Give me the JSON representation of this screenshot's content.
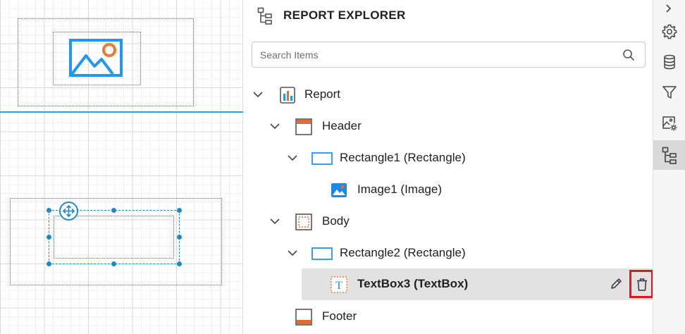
{
  "explorer": {
    "title": "REPORT EXPLORER",
    "search_placeholder": "Search Items",
    "tree": [
      {
        "label": "Report",
        "icon": "report-icon",
        "level": 0,
        "expanded": true
      },
      {
        "label": "Header",
        "icon": "header-band-icon",
        "level": 1,
        "expanded": true
      },
      {
        "label": "Rectangle1 (Rectangle)",
        "icon": "rectangle-icon",
        "level": 2,
        "expanded": true
      },
      {
        "label": "Image1 (Image)",
        "icon": "image-icon",
        "level": 3
      },
      {
        "label": "Body",
        "icon": "body-band-icon",
        "level": 1,
        "expanded": true
      },
      {
        "label": "Rectangle2 (Rectangle)",
        "icon": "rectangle-icon",
        "level": 2,
        "expanded": true
      },
      {
        "label": "TextBox3 (TextBox)",
        "icon": "textbox-icon",
        "level": 3,
        "selected": true
      },
      {
        "label": "Footer",
        "icon": "footer-band-icon",
        "level": 1
      }
    ]
  },
  "toolbar": {
    "items": [
      "gear-icon",
      "database-icon",
      "filter-icon",
      "image-settings-icon",
      "report-explorer-icon"
    ],
    "active": "report-explorer-icon"
  },
  "colors": {
    "accent": "#1e88c8",
    "band_orange": "#e86a2a",
    "delete_highlight": "#e8141d",
    "selected_row": "#e2e2e2"
  }
}
